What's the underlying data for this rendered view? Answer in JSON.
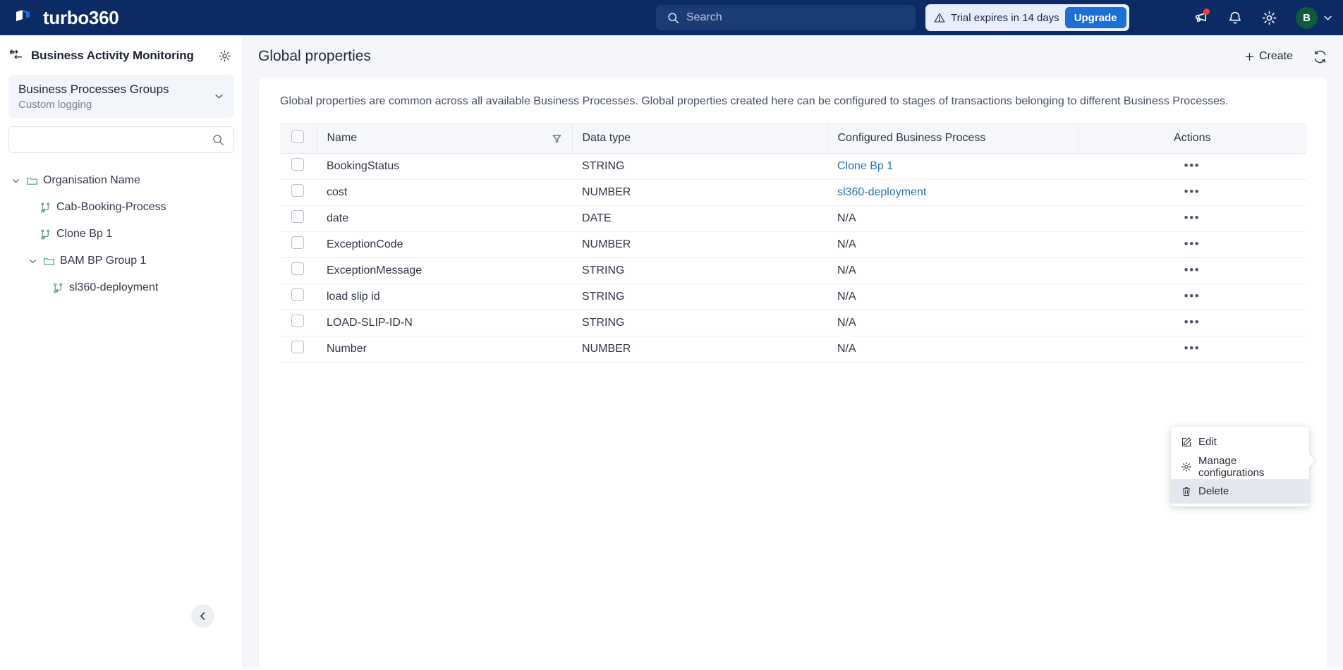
{
  "topbar": {
    "brand": "turbo360",
    "search_placeholder": "Search",
    "trial_text": "Trial expires in 14 days",
    "upgrade_label": "Upgrade",
    "avatar_initial": "B",
    "icons": [
      "announcement-icon",
      "bell-icon",
      "gear-icon"
    ]
  },
  "sidebar": {
    "title": "Business Activity Monitoring",
    "group": {
      "title": "Business Processes Groups",
      "subtitle": "Custom logging"
    },
    "search_placeholder": "",
    "search_value": "",
    "tree": [
      {
        "label": "Organisation Name",
        "type": "folder",
        "level": 0,
        "expanded": true
      },
      {
        "label": "Cab-Booking-Process",
        "type": "process",
        "level": 1
      },
      {
        "label": "Clone Bp 1",
        "type": "process",
        "level": 1
      },
      {
        "label": "BAM BP Group 1",
        "type": "folder",
        "level": 1,
        "expanded": true
      },
      {
        "label": "sl360-deployment",
        "type": "process",
        "level": 2
      }
    ]
  },
  "main": {
    "page_title": "Global properties",
    "create_label": "Create",
    "description": "Global properties are common across all available Business Processes. Global properties created here can be configured to stages of transactions belonging to different Business Processes.",
    "table": {
      "headers": [
        "Name",
        "Data type",
        "Configured Business Process",
        "Actions"
      ],
      "rows": [
        {
          "name": "BookingStatus",
          "data_type": "STRING",
          "process": "Clone Bp 1",
          "process_is_link": true
        },
        {
          "name": "cost",
          "data_type": "NUMBER",
          "process": "sl360-deployment",
          "process_is_link": true
        },
        {
          "name": "date",
          "data_type": "DATE",
          "process": "N/A",
          "process_is_link": false
        },
        {
          "name": "ExceptionCode",
          "data_type": "NUMBER",
          "process": "N/A",
          "process_is_link": false
        },
        {
          "name": "ExceptionMessage",
          "data_type": "STRING",
          "process": "N/A",
          "process_is_link": false
        },
        {
          "name": "load slip id",
          "data_type": "STRING",
          "process": "N/A",
          "process_is_link": false
        },
        {
          "name": "LOAD-SLIP-ID-N",
          "data_type": "STRING",
          "process": "N/A",
          "process_is_link": false
        },
        {
          "name": "Number",
          "data_type": "NUMBER",
          "process": "N/A",
          "process_is_link": false
        }
      ]
    }
  },
  "context_menu": {
    "items": [
      {
        "label": "Edit",
        "icon": "edit-icon",
        "active": false
      },
      {
        "label": "Manage configurations",
        "icon": "gear-icon",
        "active": false
      },
      {
        "label": "Delete",
        "icon": "trash-icon",
        "active": true
      }
    ]
  },
  "colors": {
    "topbar_bg": "#0c2a63",
    "accent_blue": "#1c6fd4",
    "link_blue": "#2c72ad",
    "tree_green": "#4f9c79",
    "avatar_green": "#0f5940",
    "notification_red": "#f03d3d"
  }
}
